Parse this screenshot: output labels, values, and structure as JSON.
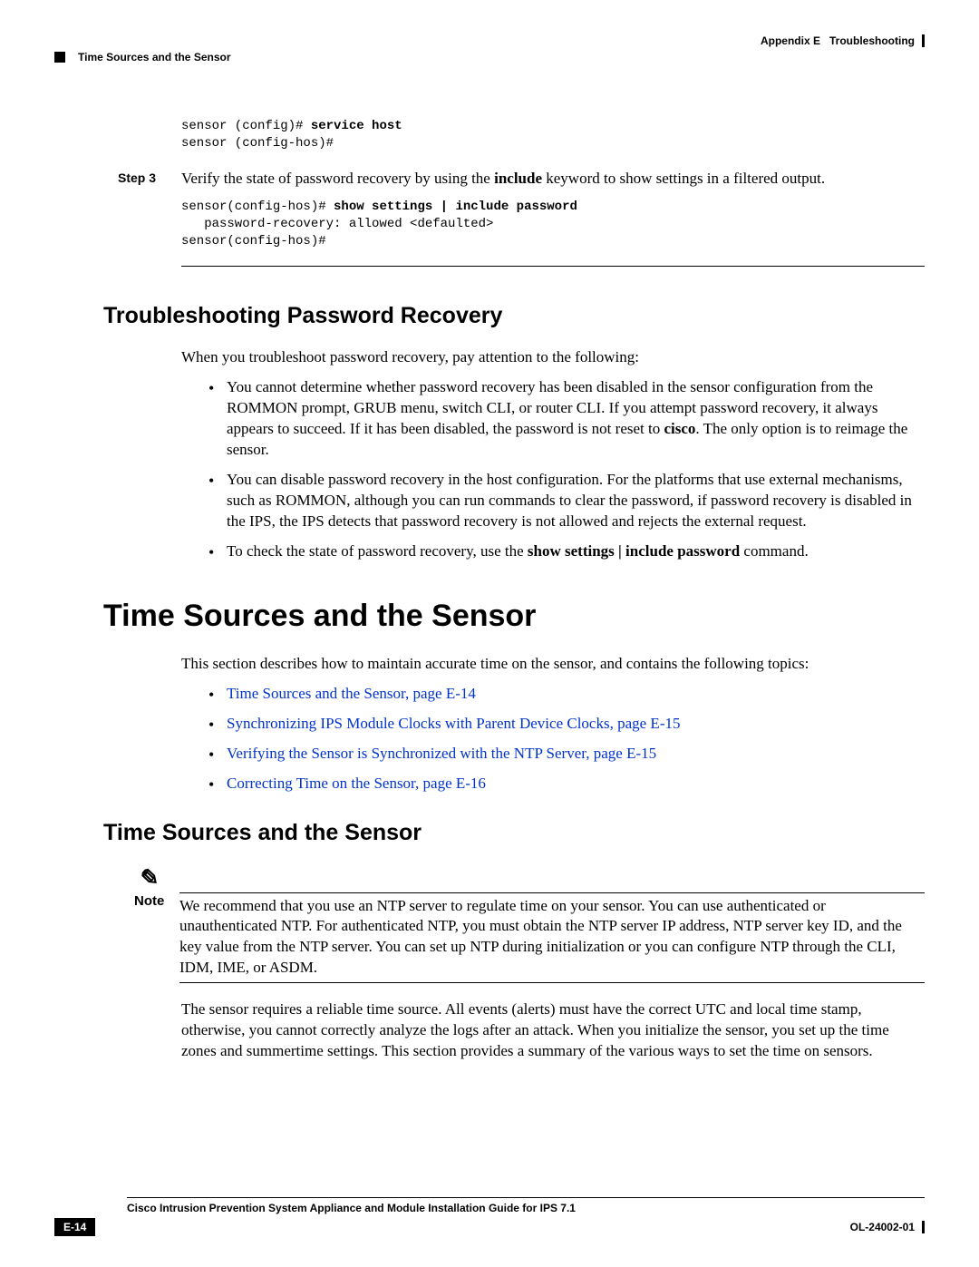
{
  "header": {
    "appendix": "Appendix E",
    "title": "Troubleshooting",
    "section": "Time Sources and the Sensor"
  },
  "code1_line1_prompt": "sensor (config)# ",
  "code1_line1_cmd": "service host",
  "code1_line2": "sensor (config-hos)#",
  "step3": {
    "label": "Step 3",
    "text_pre": "Verify the state of password recovery by using the ",
    "kw": "include",
    "text_post": " keyword to show settings in a filtered output."
  },
  "code2_line1_prompt": "sensor(config-hos)# ",
  "code2_line1_cmd": "show settings | include password",
  "code2_line2": "   password-recovery: allowed <defaulted>",
  "code2_line3": "sensor(config-hos)#",
  "h2_trouble": "Troubleshooting Password Recovery",
  "trouble_intro": "When you troubleshoot password recovery, pay attention to the following:",
  "trouble_b1_pre": "You cannot determine whether password recovery has been disabled in the sensor configuration from the ROMMON prompt, GRUB menu, switch CLI, or router CLI. If you attempt password recovery, it always appears to succeed. If it has been disabled, the password is not reset to ",
  "trouble_b1_bold": "cisco",
  "trouble_b1_post": ". The only option is to reimage the sensor.",
  "trouble_b2": "You can disable password recovery in the host configuration. For the platforms that use external mechanisms, such as ROMMON, although you can run commands to clear the password, if password recovery is disabled in the IPS, the IPS detects that password recovery is not allowed and rejects the external request.",
  "trouble_b3_pre": "To check the state of password recovery, use the ",
  "trouble_b3_bold": "show settings | include password",
  "trouble_b3_post": " command.",
  "h1_time": "Time Sources and the Sensor",
  "time_intro": "This section describes how to maintain accurate time on the sensor, and contains the following topics:",
  "link1": "Time Sources and the Sensor, page E-14",
  "link2": "Synchronizing IPS Module Clocks with Parent Device Clocks, page E-15",
  "link3": "Verifying the Sensor is Synchronized with the NTP Server, page E-15",
  "link4": "Correcting Time on the Sensor, page E-16",
  "h2_time": "Time Sources and the Sensor",
  "note_label": "Note",
  "note_text": "We recommend that you use an NTP server to regulate time on your sensor. You can use authenticated or unauthenticated NTP. For authenticated NTP, you must obtain the NTP server IP address, NTP server key ID, and the key value from the NTP server. You can set up NTP during initialization or you can configure NTP through the CLI, IDM, IME, or ASDM.",
  "time_para": "The sensor requires a reliable time source. All events (alerts) must have the correct UTC and local time stamp, otherwise, you cannot correctly analyze the logs after an attack. When you initialize the sensor, you set up the time zones and summertime settings. This section provides a summary of the various ways to set the time on sensors.",
  "footer": {
    "doc_title": "Cisco Intrusion Prevention System Appliance and Module Installation Guide for IPS 7.1",
    "page": "E-14",
    "doc_id": "OL-24002-01"
  }
}
